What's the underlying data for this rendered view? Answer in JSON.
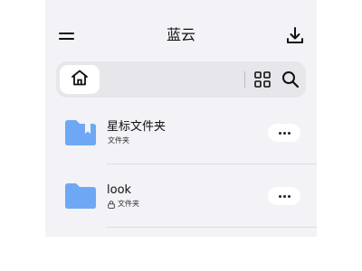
{
  "header": {
    "title": "蓝云",
    "menu_icon": "hamburger-menu-icon",
    "download_icon": "download-icon"
  },
  "toolbar": {
    "home_icon": "home-icon",
    "grid_icon": "grid-view-icon",
    "search_icon": "search-icon"
  },
  "files": [
    {
      "name": "星标文件夹",
      "type_label": "文件夹",
      "icon": "starred-folder-icon",
      "locked": false
    },
    {
      "name": "look",
      "type_label": "文件夹",
      "icon": "folder-icon",
      "locked": true
    }
  ],
  "colors": {
    "background": "#f2f2f7",
    "folder": "#6ea8f5",
    "toolbar": "#e6e6eb"
  }
}
